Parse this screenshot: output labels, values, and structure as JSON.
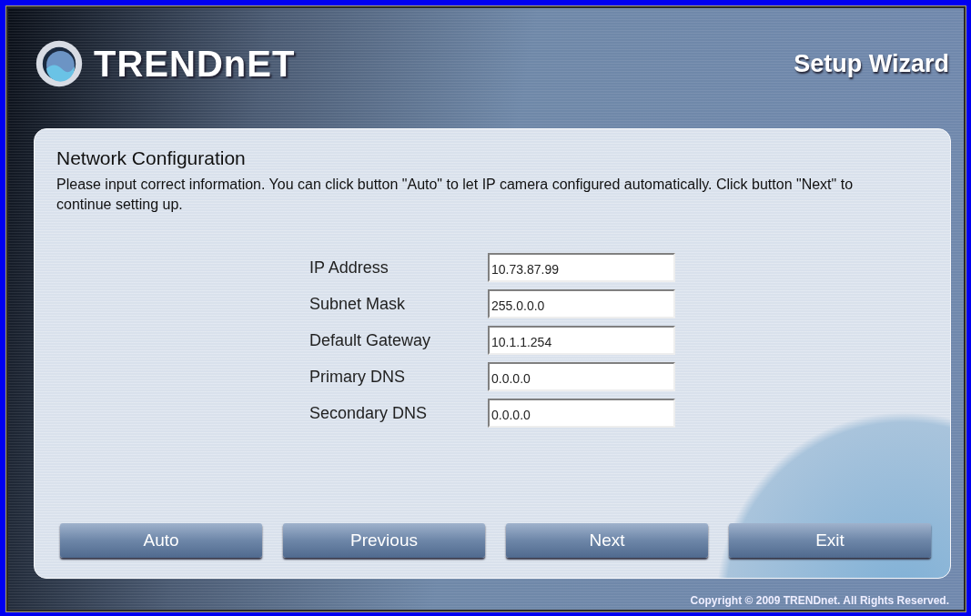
{
  "header": {
    "logo": "TRENDnET",
    "title": "Setup Wizard"
  },
  "panel": {
    "heading": "Network Configuration",
    "description": "Please input correct information. You can click button \"Auto\" to let IP camera configured automatically. Click button \"Next\" to continue setting up.",
    "fields": [
      {
        "label": "IP Address",
        "value": "10.73.87.99"
      },
      {
        "label": "Subnet Mask",
        "value": "255.0.0.0"
      },
      {
        "label": "Default Gateway",
        "value": "10.1.1.254"
      },
      {
        "label": "Primary DNS",
        "value": "0.0.0.0"
      },
      {
        "label": "Secondary DNS",
        "value": "0.0.0.0"
      }
    ],
    "buttons": [
      "Auto",
      "Previous",
      "Next",
      "Exit"
    ]
  },
  "footer": {
    "copyright": "Copyright © 2009 TRENDnet. All Rights Reserved."
  }
}
